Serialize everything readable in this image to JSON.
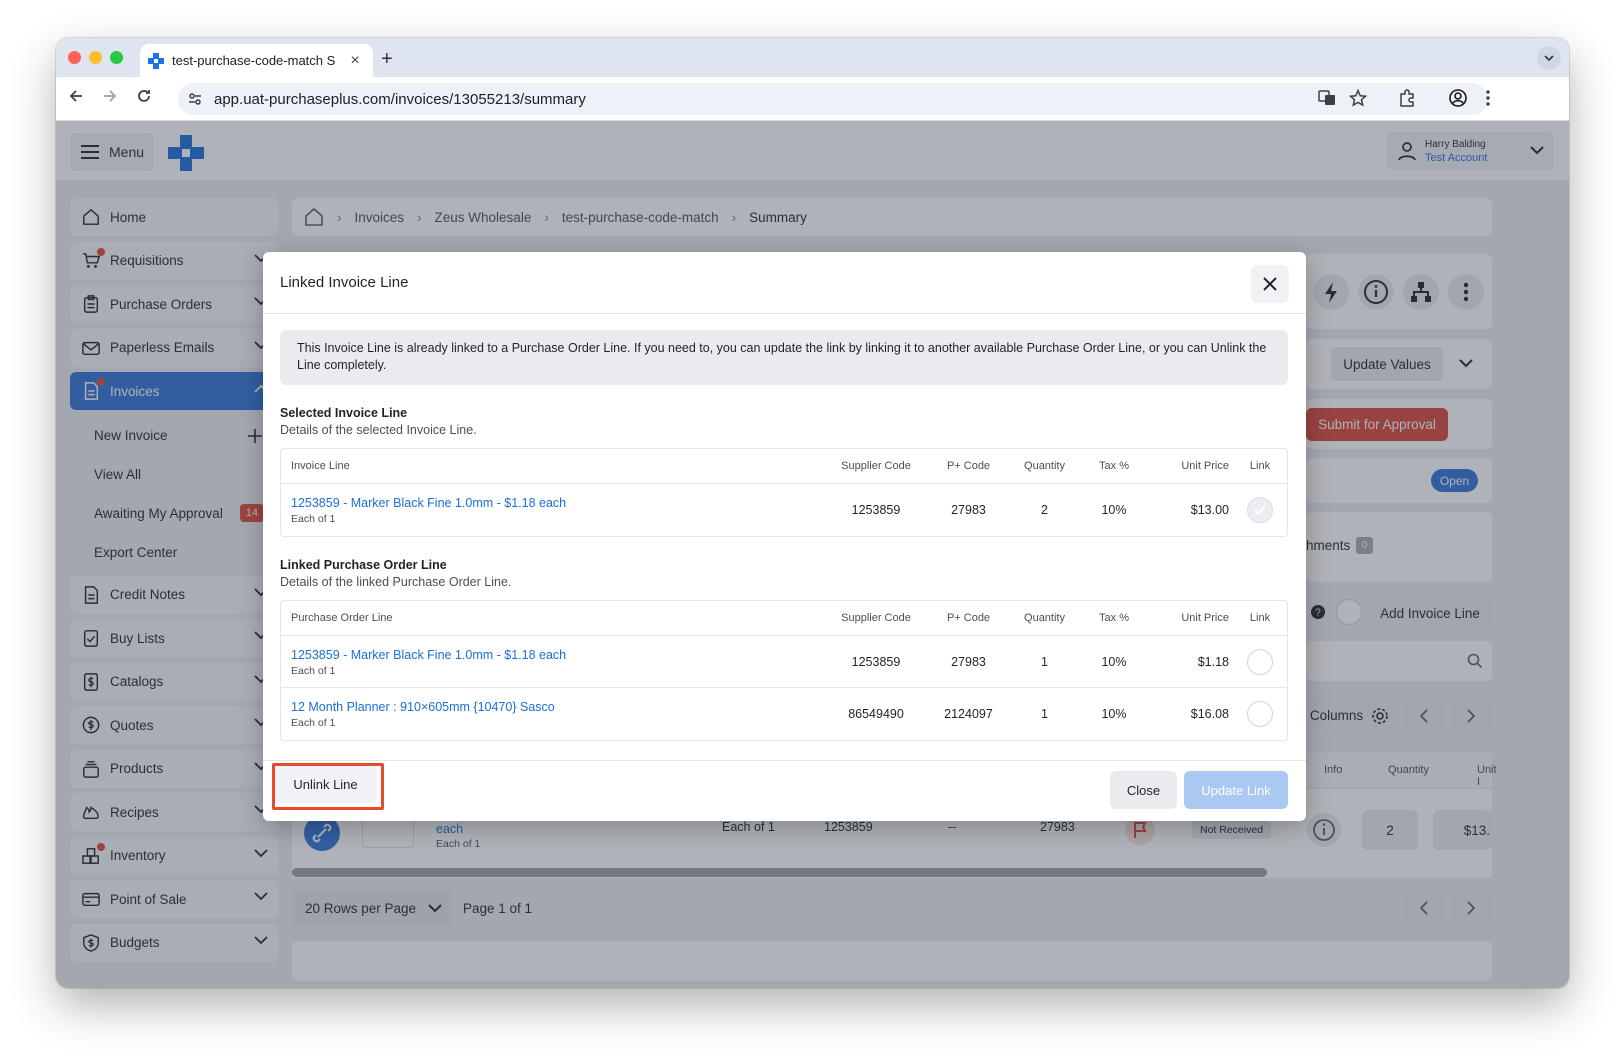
{
  "browser": {
    "tab_title": "test-purchase-code-match S",
    "url": "app.uat-purchaseplus.com/invoices/13055213/summary"
  },
  "app": {
    "menu_label": "Menu",
    "user_name": "Harry Balding",
    "account_name": "Test Account"
  },
  "sidebar": {
    "items": [
      {
        "label": "Home"
      },
      {
        "label": "Requisitions"
      },
      {
        "label": "Purchase Orders"
      },
      {
        "label": "Paperless Emails"
      },
      {
        "label": "Invoices"
      },
      {
        "label": "Credit Notes"
      },
      {
        "label": "Buy Lists"
      },
      {
        "label": "Catalogs"
      },
      {
        "label": "Quotes"
      },
      {
        "label": "Products"
      },
      {
        "label": "Recipes"
      },
      {
        "label": "Inventory"
      },
      {
        "label": "Point of Sale"
      },
      {
        "label": "Budgets"
      }
    ],
    "invoice_sub": [
      {
        "label": "New Invoice"
      },
      {
        "label": "View All"
      },
      {
        "label": "Awaiting My Approval",
        "badge": "14"
      },
      {
        "label": "Export Center"
      }
    ]
  },
  "breadcrumb": [
    "Invoices",
    "Zeus Wholesale",
    "test-purchase-code-match",
    "Summary"
  ],
  "page": {
    "update_values": "Update Values",
    "submit_for_approval": "Submit for Approval",
    "status": "Open",
    "attachments_label": "hments",
    "attachments_count": "0",
    "add_invoice_line": "Add Invoice Line",
    "columns_label": "Columns",
    "col_info": "Info",
    "col_quantity": "Quantity",
    "col_unit": "Unit I",
    "row_each": "each",
    "row_each_of": "Each of 1",
    "row_unit": "Each of 1",
    "row_code": "1253859",
    "row_dash": "--",
    "row_pcode": "27983",
    "row_status": "Not Received",
    "row_qty": "2",
    "row_price": "$13.",
    "rows_per_page": "20 Rows per Page",
    "page_info": "Page 1 of 1"
  },
  "modal": {
    "title": "Linked Invoice Line",
    "note": "This Invoice Line is already linked to a Purchase Order Line. If you need to, you can update the link by linking it to another available Purchase Order Line, or you can Unlink the Line completely.",
    "selected_heading": "Selected Invoice Line",
    "selected_desc": "Details of the selected Invoice Line.",
    "selected_headers": [
      "Invoice Line",
      "Supplier Code",
      "P+ Code",
      "Quantity",
      "Tax %",
      "Unit Price",
      "Link"
    ],
    "selected_rows": [
      {
        "name": "1253859 - Marker Black Fine 1.0mm - $1.18 each",
        "unit": "Each of 1",
        "supplier_code": "1253859",
        "p_code": "27983",
        "quantity": "2",
        "tax": "10%",
        "unit_price": "$13.00",
        "linked": true
      }
    ],
    "linked_heading": "Linked Purchase Order Line",
    "linked_desc": "Details of the linked Purchase Order Line.",
    "linked_headers": [
      "Purchase Order Line",
      "Supplier Code",
      "P+ Code",
      "Quantity",
      "Tax %",
      "Unit Price",
      "Link"
    ],
    "linked_rows": [
      {
        "name": "1253859 - Marker Black Fine 1.0mm - $1.18 each",
        "unit": "Each of 1",
        "supplier_code": "1253859",
        "p_code": "27983",
        "quantity": "1",
        "tax": "10%",
        "unit_price": "$1.18",
        "linked": false
      },
      {
        "name": "12 Month Planner : 910×605mm {10470} Sasco",
        "unit": "Each of 1",
        "supplier_code": "86549490",
        "p_code": "2124097",
        "quantity": "1",
        "tax": "10%",
        "unit_price": "$16.08",
        "linked": false
      }
    ],
    "unlink_label": "Unlink Line",
    "close_label": "Close",
    "update_label": "Update Link"
  },
  "colors": {
    "accent": "#2f74d8",
    "danger": "#d9473a",
    "link": "#1a6fd8",
    "highlight": "#e44c2c"
  }
}
